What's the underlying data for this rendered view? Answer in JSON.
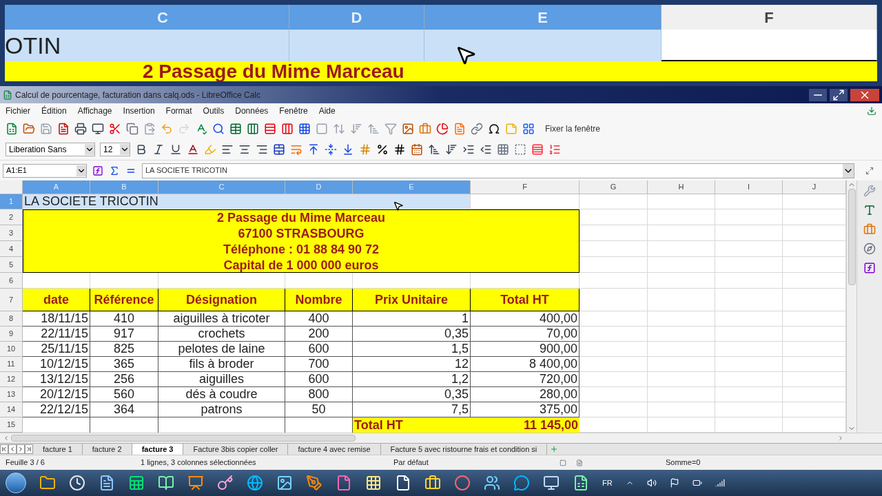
{
  "magnifier": {
    "columns": [
      {
        "label": "C",
        "selected": true
      },
      {
        "label": "D",
        "selected": true
      },
      {
        "label": "E",
        "selected": true
      },
      {
        "label": "F",
        "selected": false
      }
    ],
    "cell_text": "OTIN",
    "banner_text": "2 Passage du Mime Marceau"
  },
  "window": {
    "title": "Calcul de pourcentage, facturation dans calq.ods - LibreOffice Calc"
  },
  "menu": [
    "Fichier",
    "Édition",
    "Affichage",
    "Insertion",
    "Format",
    "Outils",
    "Données",
    "Fenêtre",
    "Aide"
  ],
  "toolbar": {
    "freeze_label": "Fixer la fenêtre",
    "font_name": "Liberation Sans",
    "font_size": "12"
  },
  "formula_bar": {
    "name_box": "A1:E1",
    "content": "LA SOCIETE TRICOTIN"
  },
  "sheet": {
    "columns": [
      {
        "label": "A",
        "selected": true
      },
      {
        "label": "B",
        "selected": true
      },
      {
        "label": "C",
        "selected": true
      },
      {
        "label": "D",
        "selected": true
      },
      {
        "label": "E",
        "selected": true
      },
      {
        "label": "F",
        "selected": false
      },
      {
        "label": "G",
        "selected": false
      },
      {
        "label": "H",
        "selected": false
      },
      {
        "label": "I",
        "selected": false
      },
      {
        "label": "J",
        "selected": false
      }
    ],
    "rows": [
      {
        "label": "1",
        "selected": true
      },
      {
        "label": "2",
        "selected": false
      },
      {
        "label": "3",
        "selected": false
      },
      {
        "label": "4",
        "selected": false
      },
      {
        "label": "5",
        "selected": false
      },
      {
        "label": "6",
        "selected": false
      },
      {
        "label": "7",
        "selected": false
      },
      {
        "label": "8",
        "selected": false
      },
      {
        "label": "9",
        "selected": false
      },
      {
        "label": "10",
        "selected": false
      },
      {
        "label": "11",
        "selected": false
      },
      {
        "label": "12",
        "selected": false
      },
      {
        "label": "13",
        "selected": false
      },
      {
        "label": "14",
        "selected": false
      },
      {
        "label": "15",
        "selected": false
      }
    ],
    "title_cell": "LA SOCIETE TRICOTIN",
    "address_lines": [
      "2 Passage du Mime Marceau",
      "67100 STRASBOURG",
      "Téléphone : 01 88 84 90 72",
      "Capital de 1 000 000 euros"
    ],
    "table": {
      "headers": [
        "date",
        "Référence",
        "Désignation",
        "Nombre",
        "Prix Unitaire",
        "Total HT"
      ],
      "rows": [
        [
          "18/11/15",
          "410",
          "aiguilles à tricoter",
          "400",
          "1",
          "400,00"
        ],
        [
          "22/11/15",
          "917",
          "crochets",
          "200",
          "0,35",
          "70,00"
        ],
        [
          "25/11/15",
          "825",
          "pelotes de laine",
          "600",
          "1,5",
          "900,00"
        ],
        [
          "10/12/15",
          "365",
          "fils à broder",
          "700",
          "12",
          "8 400,00"
        ],
        [
          "13/12/15",
          "256",
          "aiguilles",
          "600",
          "1,2",
          "720,00"
        ],
        [
          "20/12/15",
          "560",
          "dés à coudre",
          "800",
          "0,35",
          "280,00"
        ],
        [
          "22/12/15",
          "364",
          "patrons",
          "50",
          "7,5",
          "375,00"
        ]
      ]
    },
    "total": {
      "label": "Total HT",
      "value": "11 145,00"
    }
  },
  "sheet_tabs": [
    {
      "label": "facture 1",
      "selected": false
    },
    {
      "label": "facture 2",
      "selected": false
    },
    {
      "label": "facture 3",
      "selected": true
    },
    {
      "label": "Facture 3bis copier coller",
      "selected": false
    },
    {
      "label": "facture 4 avec  remise",
      "selected": false
    },
    {
      "label": "Facture 5 avec ristourne frais et condition si",
      "selected": false
    }
  ],
  "status_bar": {
    "sheet": "Feuille 3 / 6",
    "selection": "1 lignes, 3 colonnes sélectionnées",
    "style": "Par défaut",
    "sum": "Somme=0"
  },
  "taskbar": {
    "language": "FR"
  }
}
